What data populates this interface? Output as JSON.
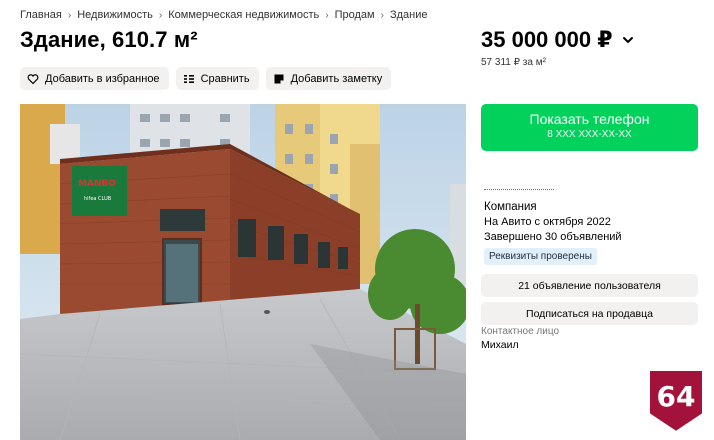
{
  "breadcrumb": [
    "Главная",
    "Недвижимость",
    "Коммерческая недвижимость",
    "Продам",
    "Здание"
  ],
  "title": "Здание, 610.7 м²",
  "price": "35 000 000 ₽",
  "price_per_m2": "57 311 ₽ за м²",
  "actions": {
    "favorite": "Добавить в избранное",
    "compare": "Сравнить",
    "note": "Добавить заметку"
  },
  "photo": {
    "sign_text": "MANBO",
    "sign_sub": "hifea CLUB"
  },
  "phone_button": {
    "label": "Показать телефон",
    "number": "8 XXX XXX-XX-XX"
  },
  "seller": {
    "type": "Компания",
    "since": "На Авито с октября 2022",
    "completed": "Завершено 30 объявлений",
    "badge": "Реквизиты проверены"
  },
  "buttons": {
    "user_ads": "21 объявление пользователя",
    "subscribe": "Подписаться на продавца"
  },
  "contact": {
    "label": "Контактное лицо",
    "name": "Михаил"
  },
  "logo": {
    "text": "64",
    "color": "#a3123a"
  },
  "colors": {
    "accent_green": "#02d15c",
    "button_grey": "#f2f1f0",
    "badge_blue": "#e1f0fb"
  },
  "icons": [
    "heart-icon",
    "compare-icon",
    "note-icon",
    "chevron-down-icon"
  ]
}
